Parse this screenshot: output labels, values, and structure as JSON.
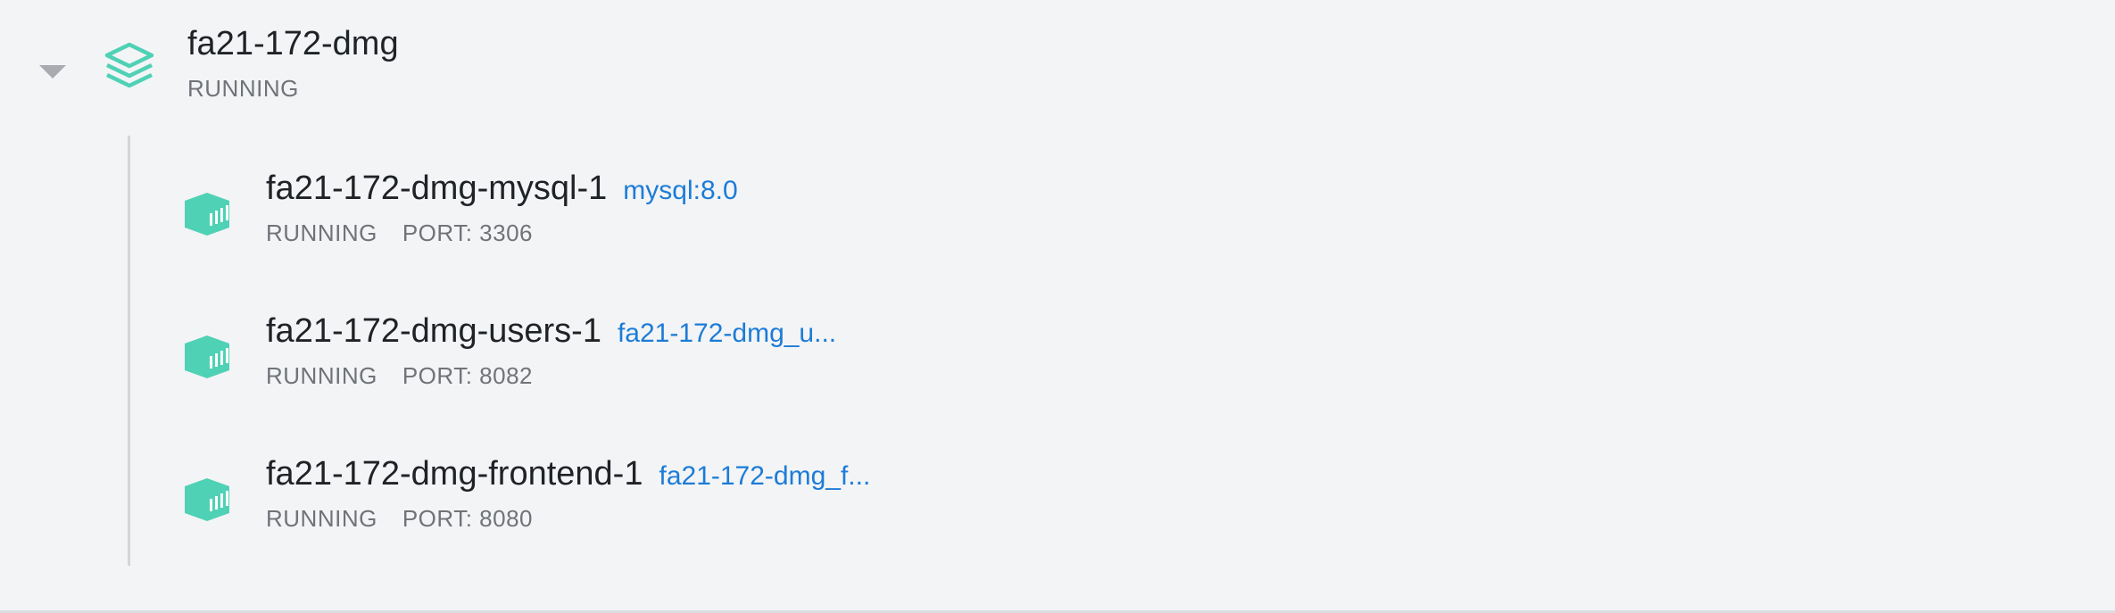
{
  "group": {
    "name": "fa21-172-dmg",
    "status": "RUNNING"
  },
  "containers": [
    {
      "name": "fa21-172-dmg-mysql-1",
      "image": "mysql:8.0",
      "status": "RUNNING",
      "port": "PORT: 3306"
    },
    {
      "name": "fa21-172-dmg-users-1",
      "image": "fa21-172-dmg_u...",
      "status": "RUNNING",
      "port": "PORT: 8082"
    },
    {
      "name": "fa21-172-dmg-frontend-1",
      "image": "fa21-172-dmg_f...",
      "status": "RUNNING",
      "port": "PORT: 8080"
    }
  ],
  "colors": {
    "accent": "#4fd1b5",
    "link": "#1c7cd6",
    "text": "#1f2226",
    "muted": "#707378",
    "background": "#f3f4f6"
  }
}
